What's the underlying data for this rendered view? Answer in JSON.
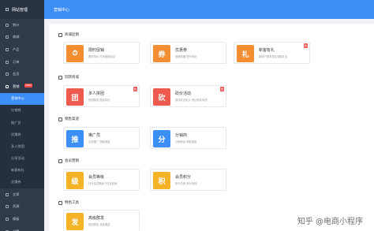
{
  "app": {
    "title": "网站管理"
  },
  "topbar": {
    "title": "营销中心"
  },
  "sidebar": {
    "items": [
      {
        "label": "统计",
        "icon": "chart-icon"
      },
      {
        "label": "商城",
        "icon": "store-icon"
      },
      {
        "label": "产品",
        "icon": "box-icon"
      },
      {
        "label": "订单",
        "icon": "order-icon"
      },
      {
        "label": "会员",
        "icon": "user-icon"
      },
      {
        "label": "营销",
        "icon": "marketing-icon",
        "badge": "NEW"
      }
    ],
    "subitems": [
      "营销中心",
      "分销商",
      "推广员",
      "优惠券",
      "多人拼团",
      "分享活动",
      "新客有礼",
      "优惠券"
    ],
    "bottom_items": [
      {
        "label": "文章",
        "icon": "article-icon"
      },
      {
        "label": "资源",
        "icon": "resource-icon"
      },
      {
        "label": "模板",
        "icon": "template-icon"
      },
      {
        "label": "设置",
        "icon": "settings-icon"
      }
    ]
  },
  "sections": [
    {
      "title": "商城促销",
      "cards": [
        {
          "title": "限时促销",
          "desc": "限时特价 打折促销活动",
          "color": "#f48e32",
          "glyph": "⏱"
        },
        {
          "title": "优惠券",
          "desc": "营销利器 提升转化",
          "color": "#f48e32",
          "glyph": "券"
        },
        {
          "title": "新客有礼",
          "desc": "新用户首次进店领取礼包",
          "color": "#f48e32",
          "glyph": "礼",
          "corner": "新"
        }
      ]
    },
    {
      "title": "玩转商城",
      "cards": [
        {
          "title": "多人拼团",
          "desc": "拼团裂变 提高转化",
          "color": "#ef5a4e",
          "glyph": "团",
          "corner": "热"
        },
        {
          "title": "砍价活动",
          "desc": "邀请好友砍价 低价购买商品",
          "color": "#ef5a4e",
          "glyph": "砍",
          "corner": "热"
        }
      ]
    },
    {
      "title": "销售渠道",
      "cards": [
        {
          "title": "推广员",
          "desc": "互相推广 获取佣金",
          "color": "#3c8ff7",
          "glyph": "推"
        },
        {
          "title": "分销商",
          "desc": "分销商品 获取佣金",
          "color": "#3c8ff7",
          "glyph": "分"
        }
      ]
    },
    {
      "title": "会员营销",
      "cards": [
        {
          "title": "会员等级",
          "desc": "针对会员等级个性化营销",
          "color": "#f5b328",
          "glyph": "级"
        },
        {
          "title": "会员积分",
          "desc": "积分兑换 积分抵现",
          "color": "#f5b328",
          "glyph": "积"
        }
      ]
    },
    {
      "title": "特色工具",
      "cards": [
        {
          "title": "高级群发",
          "desc": "短信群发 消息推送",
          "color": "#f5b328",
          "glyph": "发"
        }
      ]
    }
  ],
  "watermark": "知乎 @电商小程序"
}
